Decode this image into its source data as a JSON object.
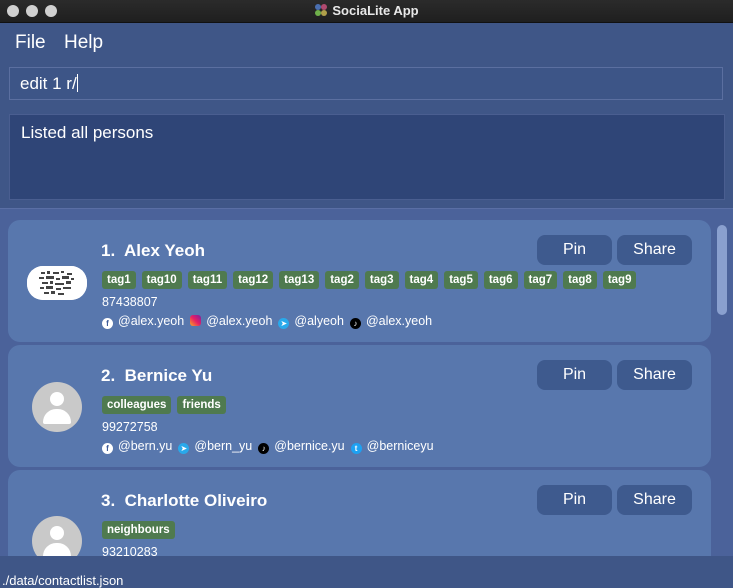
{
  "window": {
    "title": "SociaLite App"
  },
  "menu": [
    "File",
    "Help"
  ],
  "command": {
    "value": "edit 1 r/"
  },
  "result": {
    "text": "Listed all persons"
  },
  "persons": [
    {
      "index": "1.",
      "name": "Alex Yeoh",
      "tags": [
        "tag1",
        "tag10",
        "tag11",
        "tag12",
        "tag13",
        "tag2",
        "tag3",
        "tag4",
        "tag5",
        "tag6",
        "tag7",
        "tag8",
        "tag9"
      ],
      "phone": "87438807",
      "socials": [
        {
          "icon": "facebook-icon",
          "handle": "@alex.yeoh"
        },
        {
          "icon": "instagram-icon",
          "handle": "@alex.yeoh"
        },
        {
          "icon": "telegram-icon",
          "handle": "@alyeoh"
        },
        {
          "icon": "tiktok-icon",
          "handle": "@alex.yeoh"
        }
      ],
      "pin_label": "Pin",
      "share_label": "Share"
    },
    {
      "index": "2.",
      "name": "Bernice Yu",
      "tags": [
        "colleagues",
        "friends"
      ],
      "phone": "99272758",
      "socials": [
        {
          "icon": "facebook-icon",
          "handle": "@bern.yu"
        },
        {
          "icon": "telegram-icon",
          "handle": "@bern_yu"
        },
        {
          "icon": "tiktok-icon",
          "handle": "@bernice.yu"
        },
        {
          "icon": "twitter-icon",
          "handle": "@berniceyu"
        }
      ],
      "pin_label": "Pin",
      "share_label": "Share"
    },
    {
      "index": "3.",
      "name": "Charlotte Oliveiro",
      "tags": [
        "neighbours"
      ],
      "phone": "93210283",
      "socials": [],
      "pin_label": "Pin",
      "share_label": "Share"
    }
  ],
  "status": {
    "path": "./data/contactlist.json"
  }
}
